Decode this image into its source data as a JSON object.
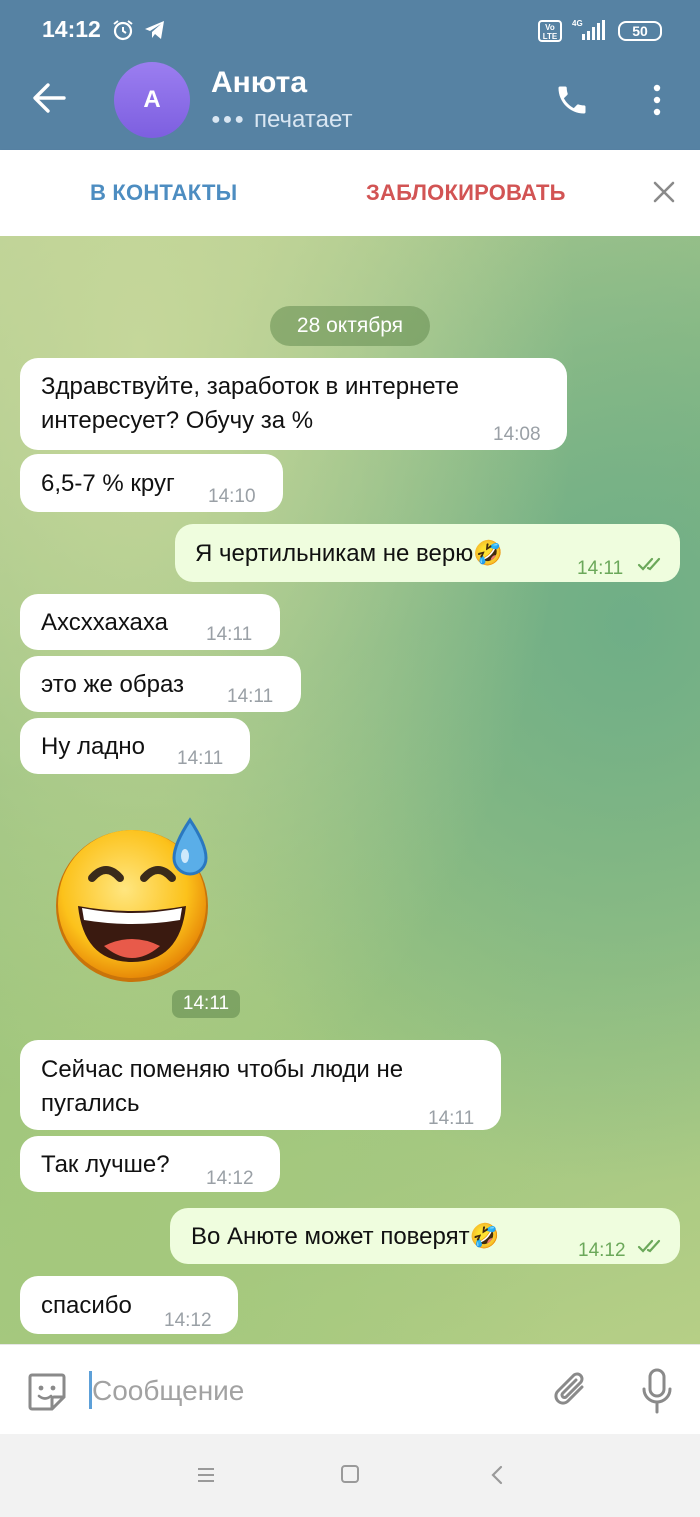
{
  "status_bar": {
    "time": "14:12",
    "volte": "Vo LTE",
    "network": "4G",
    "battery": "50"
  },
  "header": {
    "avatar_letter": "A",
    "name": "Анюта",
    "status": "печатает"
  },
  "actions": {
    "add_contact": "В КОНТАКТЫ",
    "block": "ЗАБЛОКИРОВАТЬ"
  },
  "chat": {
    "date": "28 октября",
    "messages": [
      {
        "side": "in",
        "line1": "Здравствуйте, заработок в интернете",
        "line2": "интересует? Обучу за %",
        "time": "14:08"
      },
      {
        "side": "in",
        "text": "6,5-7 % круг",
        "time": "14:10"
      },
      {
        "side": "out",
        "text": "Я чертильникам не верю",
        "emoji": "🤣",
        "time": "14:11",
        "read": true
      },
      {
        "side": "in",
        "text": "Ахсххахаха",
        "time": "14:11"
      },
      {
        "side": "in",
        "text": "это же образ",
        "time": "14:11"
      },
      {
        "side": "in",
        "text": "Ну ладно",
        "time": "14:11"
      },
      {
        "side": "in",
        "type": "sticker",
        "sticker": "grinning-face-with-sweat",
        "time": "14:11"
      },
      {
        "side": "in",
        "line1": "Сейчас поменяю чтобы люди не",
        "line2": "пугались",
        "time": "14:11"
      },
      {
        "side": "in",
        "text": "Так лучше?",
        "time": "14:12"
      },
      {
        "side": "out",
        "text": "Во Анюте может поверят",
        "emoji": "🤣",
        "time": "14:12",
        "read": true
      },
      {
        "side": "in",
        "text": "спасибо",
        "time": "14:12"
      }
    ]
  },
  "composer": {
    "placeholder": "Сообщение",
    "value": ""
  },
  "colors": {
    "header": "#5682a3",
    "outgoing_bubble": "#effdde",
    "incoming_bubble": "#ffffff",
    "block": "#d25454",
    "contact": "#4d8dc1"
  }
}
